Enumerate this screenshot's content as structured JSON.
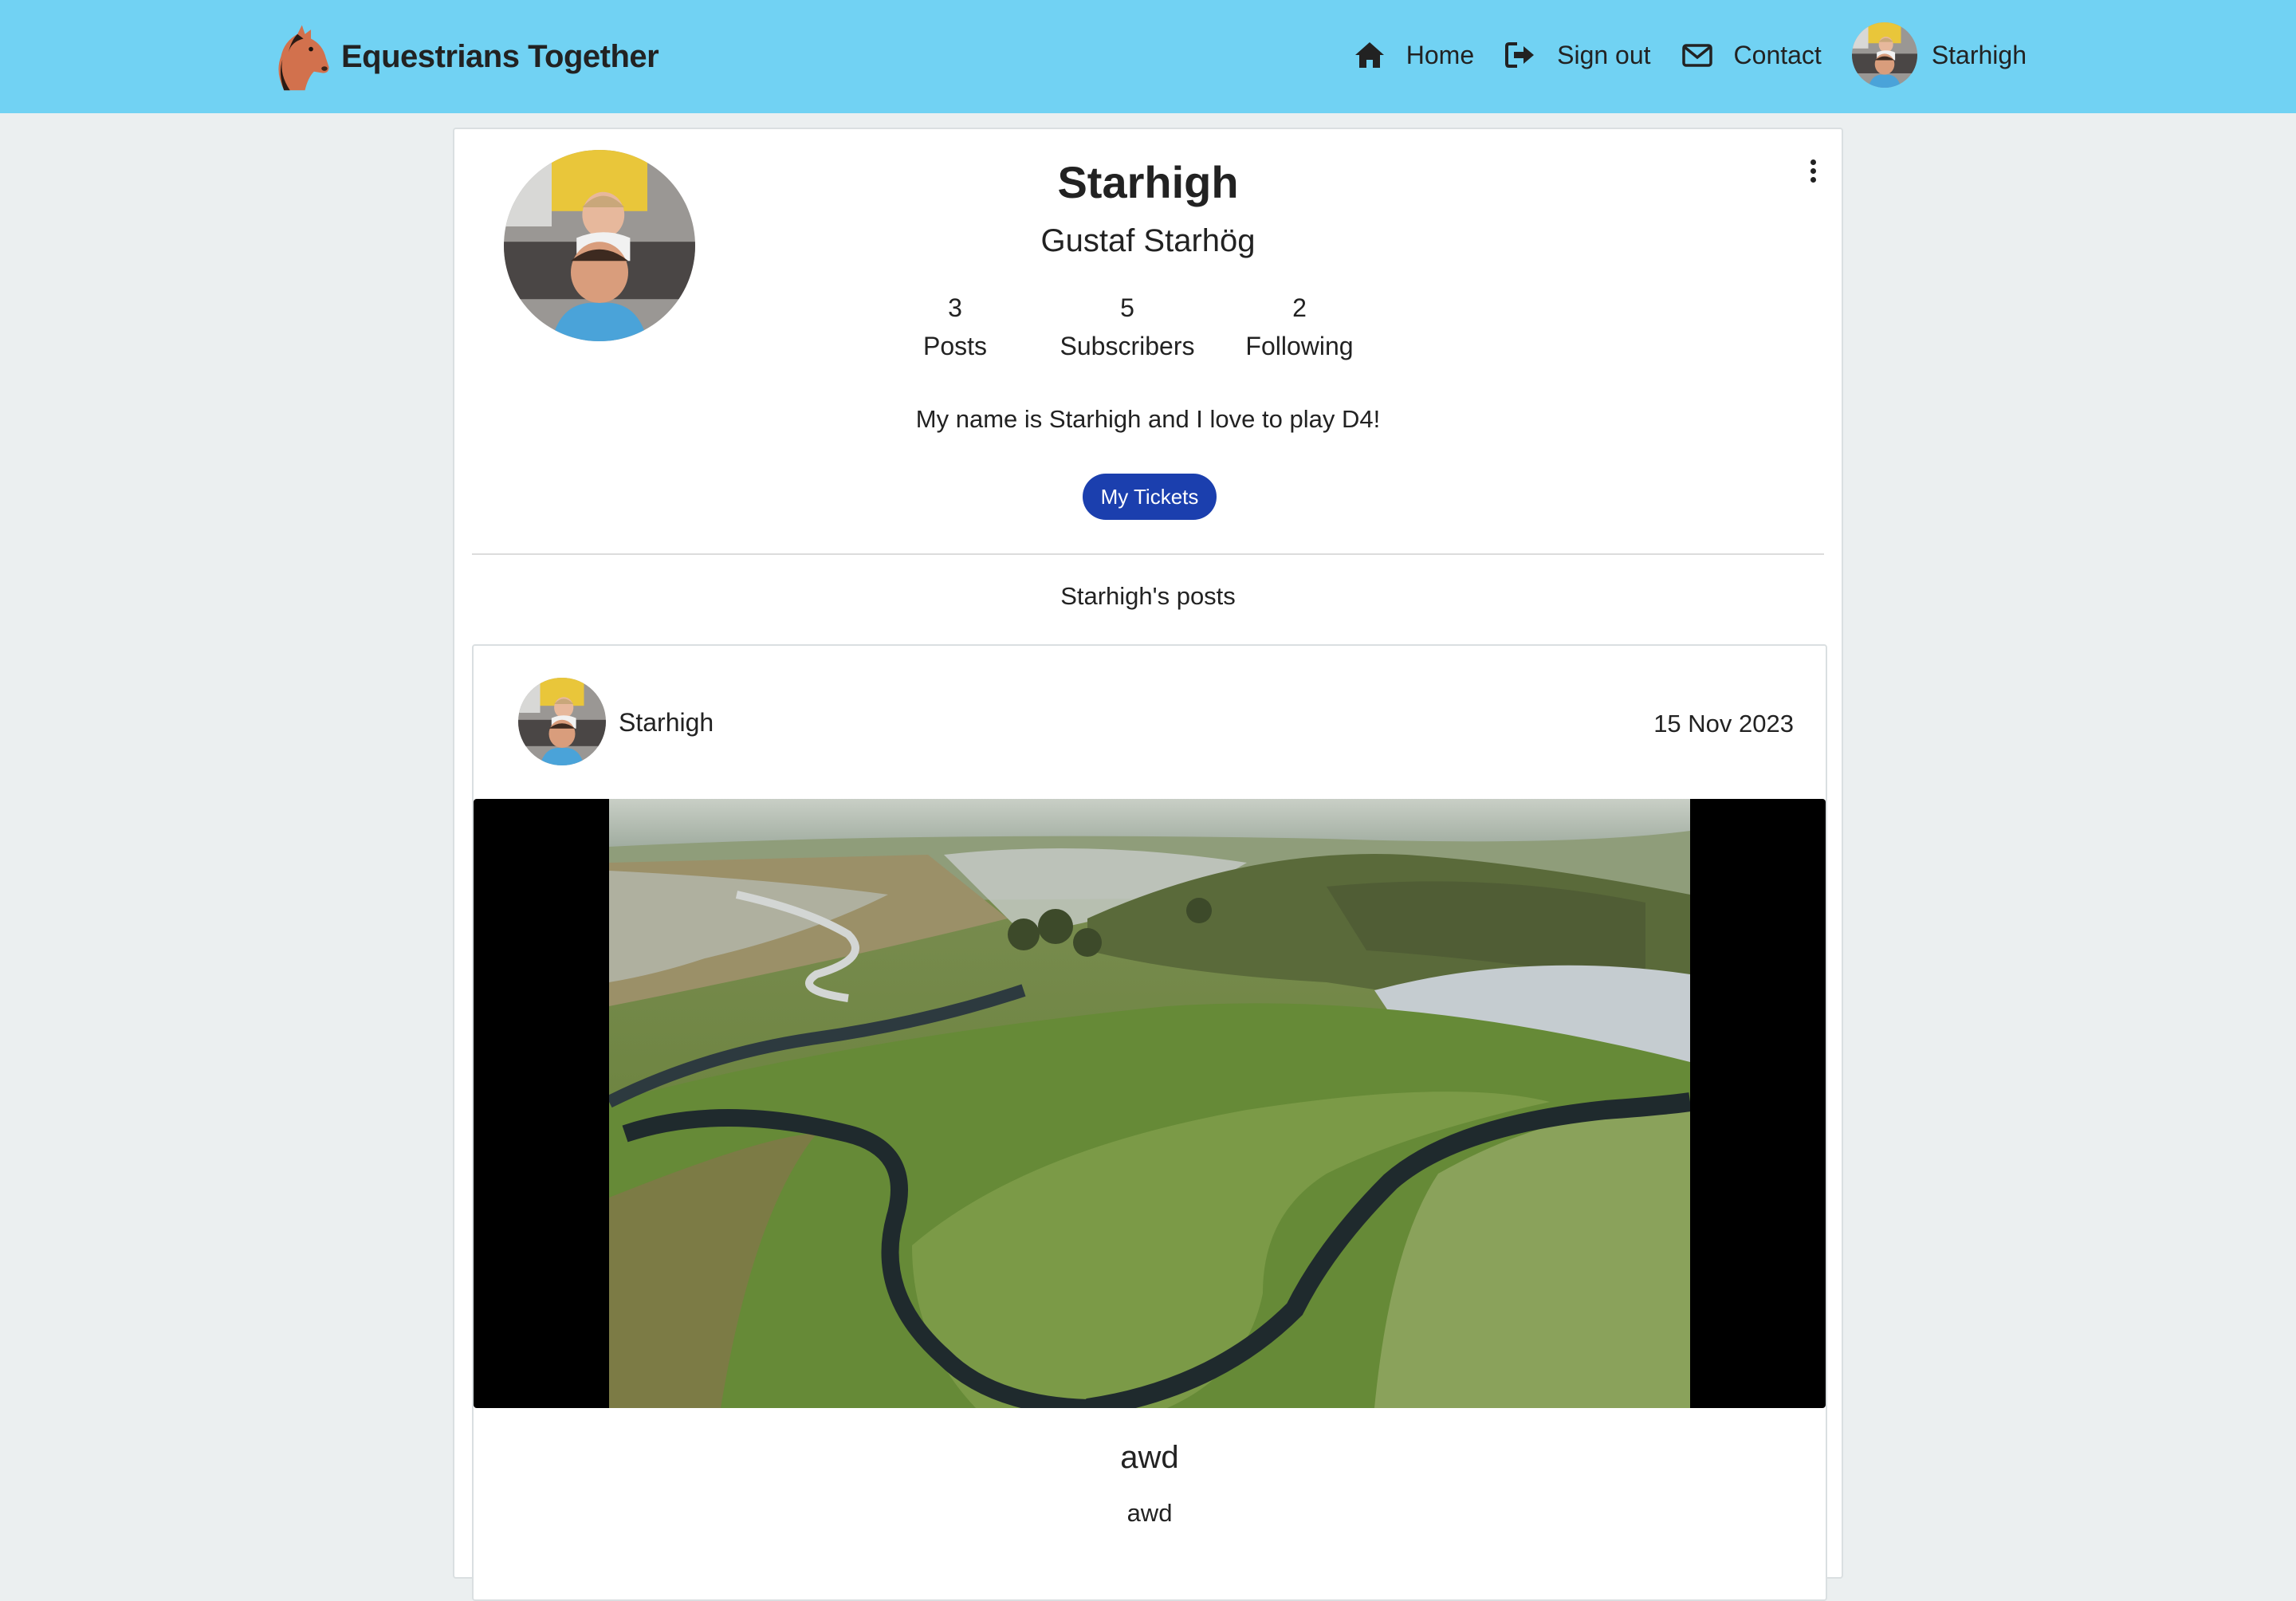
{
  "app": {
    "brand_name": "Equestrians Together"
  },
  "nav": {
    "home": {
      "label": "Home",
      "icon": "home-icon"
    },
    "signout": {
      "label": "Sign out",
      "icon": "sign-out-icon"
    },
    "contact": {
      "label": "Contact",
      "icon": "envelope-icon"
    },
    "user": {
      "label": "Starhigh"
    }
  },
  "profile": {
    "username": "Starhigh",
    "full_name": "Gustaf Starhög",
    "stats": {
      "posts": {
        "count": "3",
        "label": "Posts"
      },
      "subscribers": {
        "count": "5",
        "label": "Subscribers"
      },
      "following": {
        "count": "2",
        "label": "Following"
      }
    },
    "bio": "My name is Starhigh and I love to play D4!",
    "tickets_button": "My Tickets",
    "posts_heading": "Starhigh's posts"
  },
  "posts": [
    {
      "author": "Starhigh",
      "date": "15 Nov 2023",
      "title": "awd",
      "body": "awd"
    }
  ],
  "colors": {
    "navbar": "#71d2f3",
    "page_background": "#ebeff0",
    "primary_button": "#1b3fae"
  }
}
